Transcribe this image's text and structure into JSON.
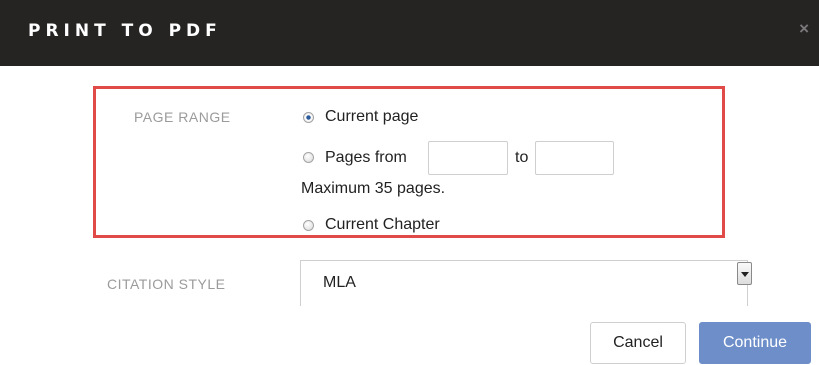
{
  "dialog": {
    "title": "PRINT TO PDF",
    "close_label": "×"
  },
  "page_range": {
    "label": "PAGE RANGE",
    "current_page_label": "Current page",
    "pages_from_label": "Pages from",
    "to_label": "to",
    "from_value": "",
    "to_value": "",
    "max_note": "Maximum 35 pages.",
    "current_chapter_label": "Current Chapter",
    "selected": "Current page"
  },
  "citation": {
    "label": "CITATION STYLE",
    "selected": "MLA"
  },
  "buttons": {
    "cancel": "Cancel",
    "continue": "Continue"
  },
  "colors": {
    "titlebar": "#262323",
    "highlight_border": "#e14b47",
    "continue_button": "#6d8ec9"
  }
}
